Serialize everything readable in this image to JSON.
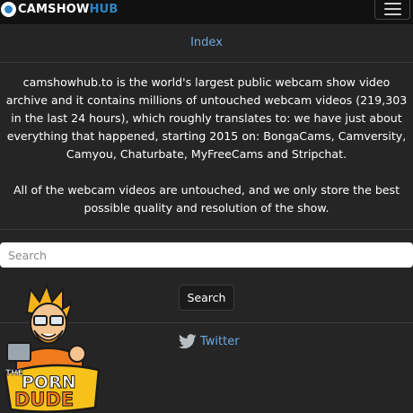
{
  "header": {
    "brand_main": "CAMSHOW",
    "brand_accent": "HUB",
    "menu_icon": "hamburger-icon"
  },
  "nav": {
    "index_label": "Index"
  },
  "intro": {
    "paragraph1": "camshowhub.to is the world's largest public webcam show video archive and it contains millions of untouched webcam videos (219,303 in the last 24 hours), which roughly translates to: we have just about everything that happened, starting 2015 on: BongaCams, Camversity, Camyou, Chaturbate, MyFreeCams and Stripchat.",
    "paragraph2": "All of the webcam videos are untouched, and we only store the best possible quality and resolution of the show."
  },
  "search": {
    "placeholder": "Search",
    "value": "",
    "button_label": "Search"
  },
  "social": {
    "twitter_label": "Twitter",
    "icon": "twitter-bird-icon"
  },
  "badge": {
    "line1": "THE",
    "line2": "PORN",
    "line3": "DUDE"
  },
  "colors": {
    "background": "#252525",
    "navbar": "#111111",
    "accent": "#2a85c8",
    "link": "#6ea8e0",
    "badge_orange": "#f07b1c",
    "badge_yellow": "#f7c11b"
  }
}
